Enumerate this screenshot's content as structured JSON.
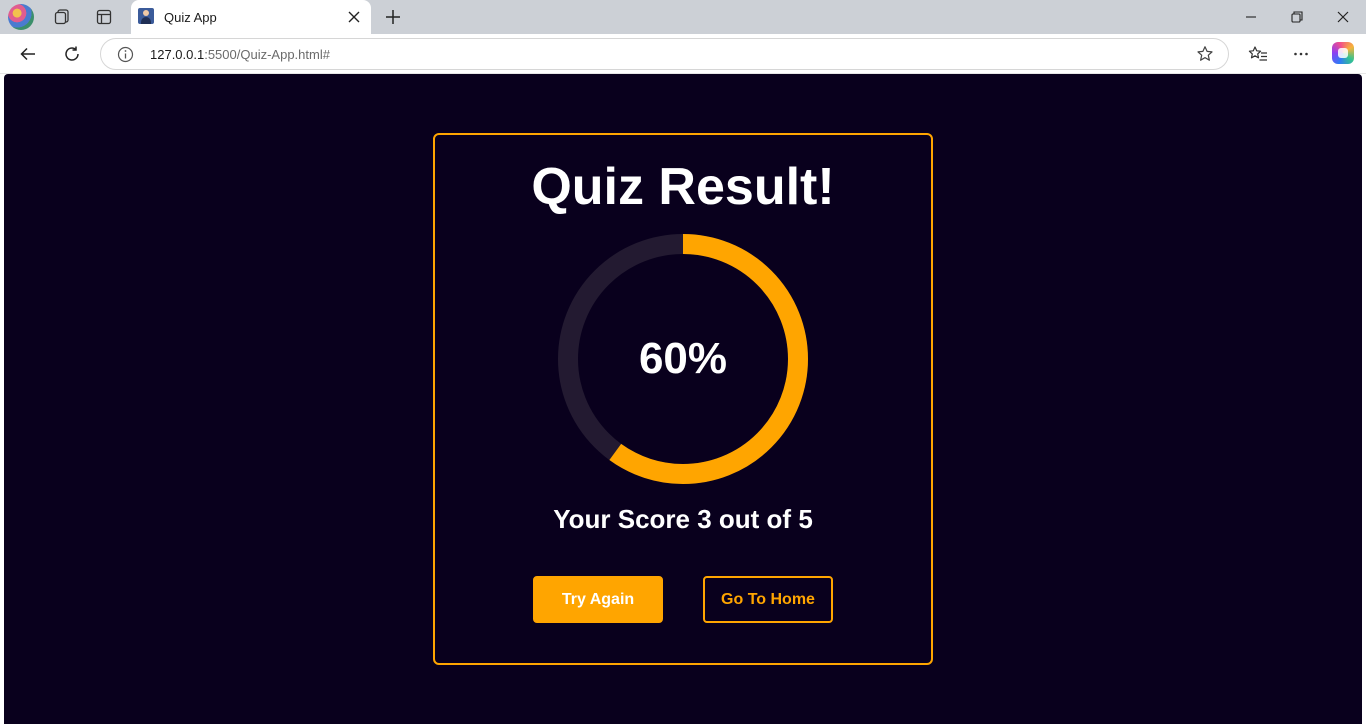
{
  "browser": {
    "tab": {
      "title": "Quiz App"
    },
    "address": {
      "host": "127.0.0.1",
      "path": ":5500/Quiz-App.html#"
    }
  },
  "page": {
    "title": "Quiz Result!",
    "progress": {
      "value": 60,
      "label": "60%"
    },
    "score": {
      "text": "Your Score 3 out of 5",
      "correct": 3,
      "total": 5
    },
    "buttons": {
      "try_again": "Try Again",
      "go_home": "Go To Home"
    }
  },
  "colors": {
    "background": "#09001d",
    "accent": "#ffa500",
    "progress_track": "#231a31",
    "text": "#ffffff"
  },
  "icons": {
    "tabbar": [
      "profile-avatar",
      "workspaces-icon",
      "tab-actions-icon",
      "close-icon",
      "plus-icon",
      "minimize-icon",
      "restore-icon",
      "close-window-icon"
    ],
    "toolbar": [
      "back-arrow-icon",
      "refresh-icon",
      "info-icon",
      "star-icon",
      "favorites-icon",
      "more-icon",
      "copilot-icon"
    ]
  }
}
